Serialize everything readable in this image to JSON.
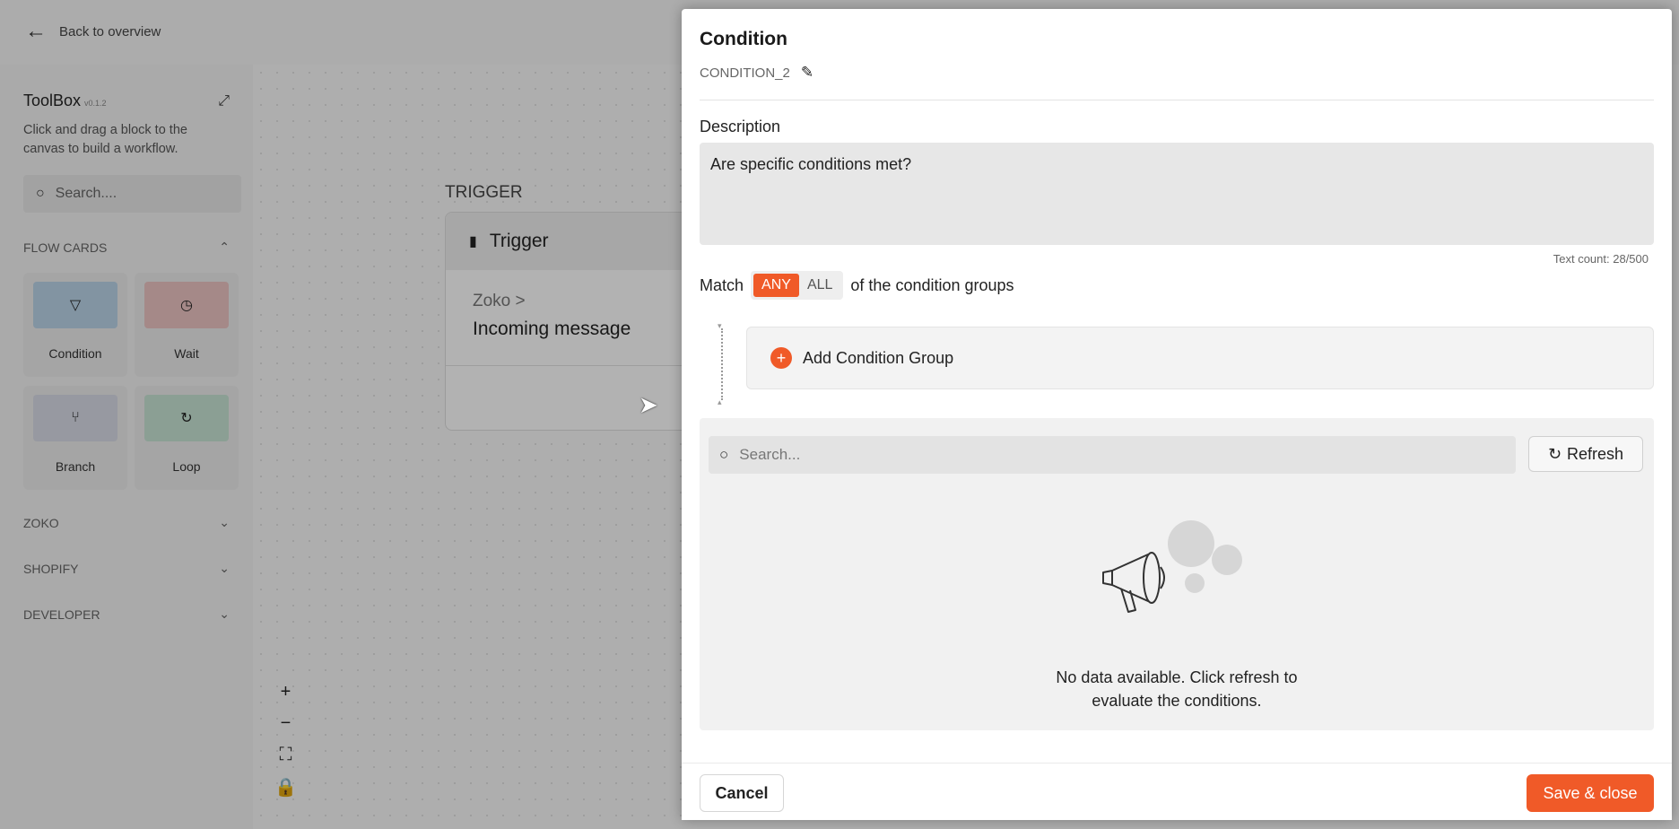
{
  "topbar": {
    "back_label": "Back to overview"
  },
  "toolbox": {
    "title": "ToolBox",
    "version": "v0.1.2",
    "description": "Click and drag a block to the canvas to build a workflow.",
    "search_placeholder": "Search....",
    "sections": {
      "flow_cards": "FLOW CARDS",
      "zoko": "ZOKO",
      "shopify": "SHOPIFY",
      "developer": "DEVELOPER"
    },
    "cards": [
      {
        "label": "Condition",
        "icon": "filter-icon",
        "color": "#b9d3e8"
      },
      {
        "label": "Wait",
        "icon": "clock-icon",
        "color": "#ecc4c2"
      },
      {
        "label": "Branch",
        "icon": "branch-icon",
        "color": "#d7dae6"
      },
      {
        "label": "Loop",
        "icon": "loop-icon",
        "color": "#c6e3d3"
      }
    ]
  },
  "canvas": {
    "trigger_label": "TRIGGER",
    "trigger_card": {
      "title": "Trigger",
      "source": "Zoko >",
      "event": "Incoming message"
    }
  },
  "panel": {
    "title": "Condition",
    "identifier": "CONDITION_2",
    "description_label": "Description",
    "description_value": "Are specific conditions met?",
    "text_count": "Text count: 28/500",
    "match_prefix": "Match",
    "match_options": [
      "ANY",
      "ALL"
    ],
    "match_selected": "ANY",
    "match_suffix": "of the condition groups",
    "add_group_label": "Add Condition Group",
    "search_placeholder": "Search...",
    "refresh_label": "Refresh",
    "empty_line1": "No data available. Click refresh to",
    "empty_line2": "evaluate the conditions.",
    "cancel_label": "Cancel",
    "save_label": "Save & close"
  },
  "colors": {
    "accent": "#f05a28"
  }
}
